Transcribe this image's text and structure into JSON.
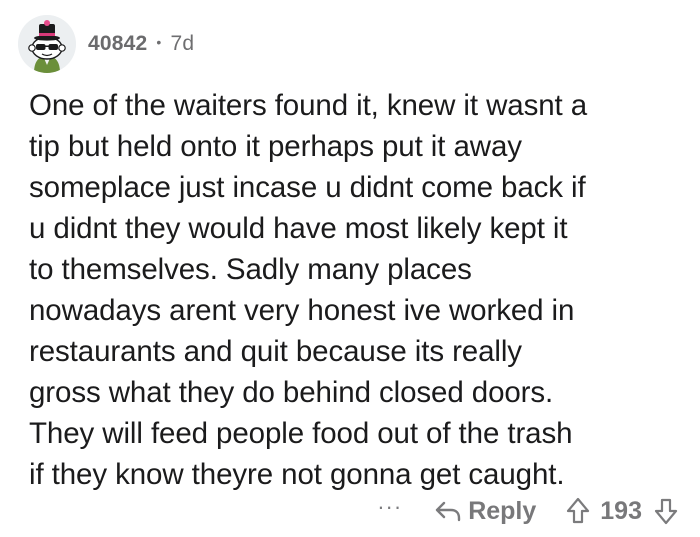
{
  "comment": {
    "username": "40842",
    "separator": "•",
    "age": "7d",
    "body": "One of the waiters found it, knew it wasnt a\ntip but held onto it perhaps put it away\nsomeplace just incase u didnt come back if\nu didnt they would have most likely kept it\nto themselves. Sadly many places\nnowadays arent very honest ive worked in\nrestaurants and quit because its really\ngross what they do behind closed doors.\nThey will feed people food out of the trash\nif they know theyre not gonna get caught."
  },
  "actions": {
    "more_label": "···",
    "reply_label": "Reply",
    "score": "193"
  },
  "icons": {
    "avatar": "snoo-avatar-with-hat-and-sunglasses",
    "reply": "reply-arrow-icon",
    "upvote": "upvote-arrow-icon",
    "downvote": "downvote-arrow-icon"
  },
  "colors": {
    "text": "#1b1b1c",
    "meta": "#6e6e70",
    "action": "#7b7b7d"
  }
}
